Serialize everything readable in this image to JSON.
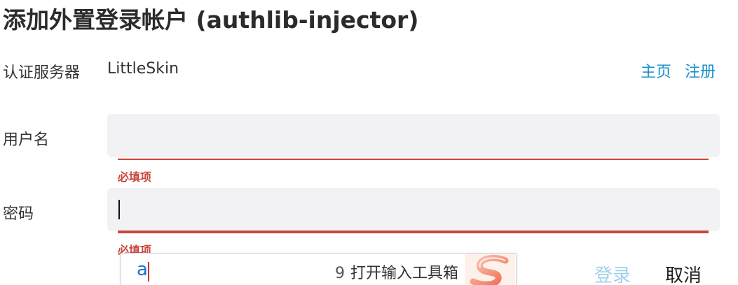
{
  "dialog": {
    "title": "添加外置登录帐户 (authlib-injector)"
  },
  "server": {
    "label": "认证服务器",
    "value": "LittleSkin",
    "links": {
      "home": "主页",
      "register": "注册"
    }
  },
  "username": {
    "label": "用户名",
    "value": "",
    "error": "必填项"
  },
  "password": {
    "label": "密码",
    "value": "",
    "error": "必填项"
  },
  "ime": {
    "input_text": "a",
    "candidate_number": "9",
    "candidate_text": "打开输入工具箱",
    "logo_icon": "sogou-logo-icon"
  },
  "actions": {
    "login": "登录",
    "cancel": "取消"
  },
  "colors": {
    "link": "#1a8fc9",
    "error": "#c9463d",
    "field_bg": "#f2f2f4",
    "login_disabled": "#9fd0ea"
  }
}
